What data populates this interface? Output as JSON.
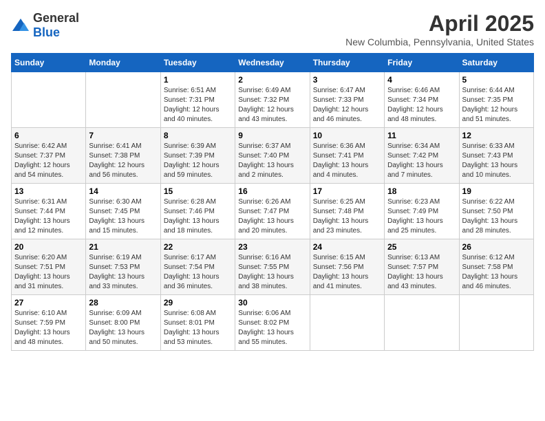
{
  "header": {
    "logo_general": "General",
    "logo_blue": "Blue",
    "title": "April 2025",
    "subtitle": "New Columbia, Pennsylvania, United States"
  },
  "weekdays": [
    "Sunday",
    "Monday",
    "Tuesday",
    "Wednesday",
    "Thursday",
    "Friday",
    "Saturday"
  ],
  "weeks": [
    [
      {
        "day": "",
        "info": ""
      },
      {
        "day": "",
        "info": ""
      },
      {
        "day": "1",
        "info": "Sunrise: 6:51 AM\nSunset: 7:31 PM\nDaylight: 12 hours and 40 minutes."
      },
      {
        "day": "2",
        "info": "Sunrise: 6:49 AM\nSunset: 7:32 PM\nDaylight: 12 hours and 43 minutes."
      },
      {
        "day": "3",
        "info": "Sunrise: 6:47 AM\nSunset: 7:33 PM\nDaylight: 12 hours and 46 minutes."
      },
      {
        "day": "4",
        "info": "Sunrise: 6:46 AM\nSunset: 7:34 PM\nDaylight: 12 hours and 48 minutes."
      },
      {
        "day": "5",
        "info": "Sunrise: 6:44 AM\nSunset: 7:35 PM\nDaylight: 12 hours and 51 minutes."
      }
    ],
    [
      {
        "day": "6",
        "info": "Sunrise: 6:42 AM\nSunset: 7:37 PM\nDaylight: 12 hours and 54 minutes."
      },
      {
        "day": "7",
        "info": "Sunrise: 6:41 AM\nSunset: 7:38 PM\nDaylight: 12 hours and 56 minutes."
      },
      {
        "day": "8",
        "info": "Sunrise: 6:39 AM\nSunset: 7:39 PM\nDaylight: 12 hours and 59 minutes."
      },
      {
        "day": "9",
        "info": "Sunrise: 6:37 AM\nSunset: 7:40 PM\nDaylight: 13 hours and 2 minutes."
      },
      {
        "day": "10",
        "info": "Sunrise: 6:36 AM\nSunset: 7:41 PM\nDaylight: 13 hours and 4 minutes."
      },
      {
        "day": "11",
        "info": "Sunrise: 6:34 AM\nSunset: 7:42 PM\nDaylight: 13 hours and 7 minutes."
      },
      {
        "day": "12",
        "info": "Sunrise: 6:33 AM\nSunset: 7:43 PM\nDaylight: 13 hours and 10 minutes."
      }
    ],
    [
      {
        "day": "13",
        "info": "Sunrise: 6:31 AM\nSunset: 7:44 PM\nDaylight: 13 hours and 12 minutes."
      },
      {
        "day": "14",
        "info": "Sunrise: 6:30 AM\nSunset: 7:45 PM\nDaylight: 13 hours and 15 minutes."
      },
      {
        "day": "15",
        "info": "Sunrise: 6:28 AM\nSunset: 7:46 PM\nDaylight: 13 hours and 18 minutes."
      },
      {
        "day": "16",
        "info": "Sunrise: 6:26 AM\nSunset: 7:47 PM\nDaylight: 13 hours and 20 minutes."
      },
      {
        "day": "17",
        "info": "Sunrise: 6:25 AM\nSunset: 7:48 PM\nDaylight: 13 hours and 23 minutes."
      },
      {
        "day": "18",
        "info": "Sunrise: 6:23 AM\nSunset: 7:49 PM\nDaylight: 13 hours and 25 minutes."
      },
      {
        "day": "19",
        "info": "Sunrise: 6:22 AM\nSunset: 7:50 PM\nDaylight: 13 hours and 28 minutes."
      }
    ],
    [
      {
        "day": "20",
        "info": "Sunrise: 6:20 AM\nSunset: 7:51 PM\nDaylight: 13 hours and 31 minutes."
      },
      {
        "day": "21",
        "info": "Sunrise: 6:19 AM\nSunset: 7:53 PM\nDaylight: 13 hours and 33 minutes."
      },
      {
        "day": "22",
        "info": "Sunrise: 6:17 AM\nSunset: 7:54 PM\nDaylight: 13 hours and 36 minutes."
      },
      {
        "day": "23",
        "info": "Sunrise: 6:16 AM\nSunset: 7:55 PM\nDaylight: 13 hours and 38 minutes."
      },
      {
        "day": "24",
        "info": "Sunrise: 6:15 AM\nSunset: 7:56 PM\nDaylight: 13 hours and 41 minutes."
      },
      {
        "day": "25",
        "info": "Sunrise: 6:13 AM\nSunset: 7:57 PM\nDaylight: 13 hours and 43 minutes."
      },
      {
        "day": "26",
        "info": "Sunrise: 6:12 AM\nSunset: 7:58 PM\nDaylight: 13 hours and 46 minutes."
      }
    ],
    [
      {
        "day": "27",
        "info": "Sunrise: 6:10 AM\nSunset: 7:59 PM\nDaylight: 13 hours and 48 minutes."
      },
      {
        "day": "28",
        "info": "Sunrise: 6:09 AM\nSunset: 8:00 PM\nDaylight: 13 hours and 50 minutes."
      },
      {
        "day": "29",
        "info": "Sunrise: 6:08 AM\nSunset: 8:01 PM\nDaylight: 13 hours and 53 minutes."
      },
      {
        "day": "30",
        "info": "Sunrise: 6:06 AM\nSunset: 8:02 PM\nDaylight: 13 hours and 55 minutes."
      },
      {
        "day": "",
        "info": ""
      },
      {
        "day": "",
        "info": ""
      },
      {
        "day": "",
        "info": ""
      }
    ]
  ]
}
